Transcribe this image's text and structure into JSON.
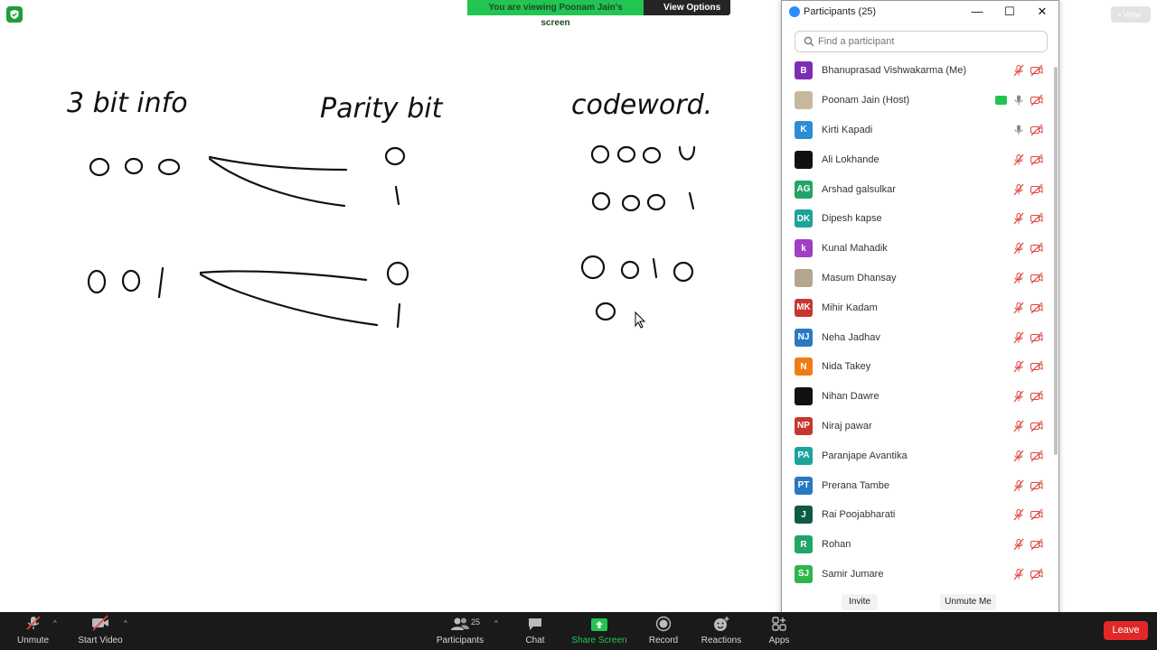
{
  "banner": {
    "viewing_text": "You are viewing Poonam Jain's screen",
    "view_options": "View Options"
  },
  "top_right": {
    "view_label": "View"
  },
  "whiteboard": {
    "title_info": "3 bit info",
    "title_parity": "Parity bit",
    "title_codeword": "codeword."
  },
  "panel": {
    "title": "Participants (25)",
    "search_placeholder": "Find a participant",
    "invite": "Invite",
    "unmute_me": "Unmute Me",
    "participants": [
      {
        "name": "Bhanuprasad Vishwakarma (Me)",
        "initials": "B",
        "color": "#7b2fb5",
        "mic": "muted"
      },
      {
        "name": "Poonam Jain (Host)",
        "initials": "",
        "color": "#c8b79f",
        "mic": "on",
        "sharing": true,
        "photo": true
      },
      {
        "name": "Kirti Kapadi",
        "initials": "K",
        "color": "#2d8cd6",
        "mic": "on"
      },
      {
        "name": "Ali Lokhande",
        "initials": "",
        "color": "#111111",
        "mic": "muted"
      },
      {
        "name": "Arshad galsulkar",
        "initials": "AG",
        "color": "#23a468",
        "mic": "muted"
      },
      {
        "name": "Dipesh kapse",
        "initials": "DK",
        "color": "#1ba39c",
        "mic": "muted"
      },
      {
        "name": "Kunal Mahadik",
        "initials": "k",
        "color": "#a03ec4",
        "mic": "muted"
      },
      {
        "name": "Masum Dhansay",
        "initials": "",
        "color": "#b5a58f",
        "mic": "muted",
        "photo": true
      },
      {
        "name": "Mihir Kadam",
        "initials": "MK",
        "color": "#c7372f",
        "mic": "muted"
      },
      {
        "name": "Neha Jadhav",
        "initials": "NJ",
        "color": "#2a78c2",
        "mic": "muted"
      },
      {
        "name": "Nida Takey",
        "initials": "N",
        "color": "#ef7d16",
        "mic": "muted"
      },
      {
        "name": "Nihan Dawre",
        "initials": "",
        "color": "#111111",
        "mic": "muted"
      },
      {
        "name": "Niraj pawar",
        "initials": "NP",
        "color": "#c7372f",
        "mic": "muted"
      },
      {
        "name": "Paranjape Avantika",
        "initials": "PA",
        "color": "#1ba39c",
        "mic": "muted"
      },
      {
        "name": "Prerana Tambe",
        "initials": "PT",
        "color": "#2a78c2",
        "mic": "muted"
      },
      {
        "name": "Rai Poojabharati",
        "initials": "J",
        "color": "#0f5a45",
        "mic": "muted"
      },
      {
        "name": "Rohan",
        "initials": "R",
        "color": "#23a468",
        "mic": "muted"
      },
      {
        "name": "Samir Jumare",
        "initials": "SJ",
        "color": "#2fb54a",
        "mic": "muted"
      }
    ]
  },
  "toolbar": {
    "unmute": "Unmute",
    "start_video": "Start Video",
    "participants": "Participants",
    "participant_count": "25",
    "chat": "Chat",
    "share_screen": "Share Screen",
    "record": "Record",
    "reactions": "Reactions",
    "apps": "Apps",
    "leave": "Leave"
  },
  "colors": {
    "accent_green": "#23c552",
    "leave_red": "#e02828",
    "muted_red": "#e0463e",
    "toolbar_bg": "#1a1a1a"
  }
}
